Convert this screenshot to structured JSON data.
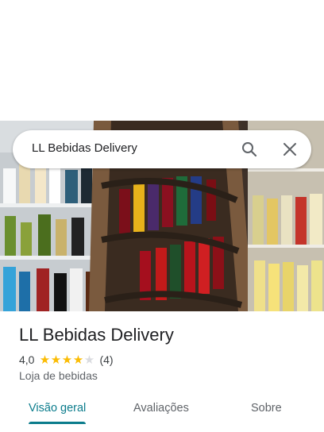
{
  "search": {
    "query": "LL Bebidas Delivery"
  },
  "place": {
    "name": "LL Bebidas Delivery",
    "rating": "4,0",
    "stars_filled": 4,
    "stars_total": 5,
    "review_count": "(4)",
    "category": "Loja de bebidas"
  },
  "tabs": [
    {
      "label": "Visão geral",
      "active": true
    },
    {
      "label": "Avaliações",
      "active": false
    },
    {
      "label": "Sobre",
      "active": false
    }
  ],
  "colors": {
    "accent": "#0b7c8c",
    "star": "#fbbc04",
    "star_empty": "#dadce0"
  },
  "icons": [
    "search-icon",
    "close-icon",
    "star-icon"
  ]
}
